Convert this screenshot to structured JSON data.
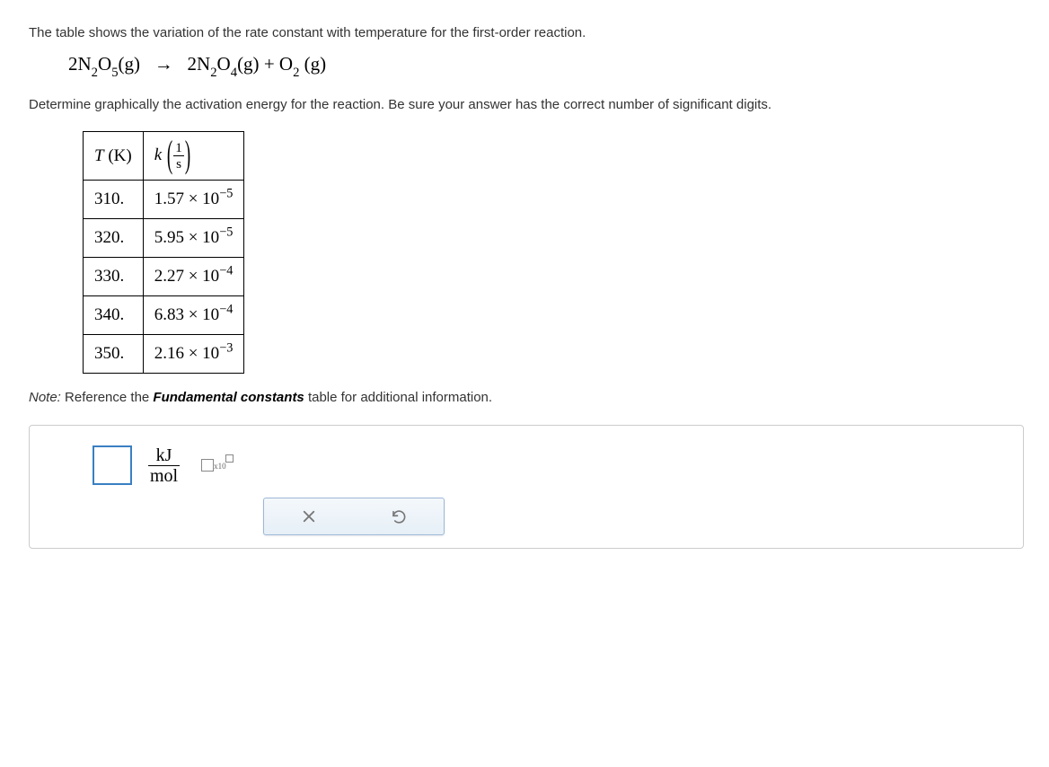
{
  "intro": "The table shows the variation of the rate constant with temperature for the first-order reaction.",
  "equation": {
    "lhs_coef": "2N",
    "lhs_sub1": "2",
    "lhs_mid": "O",
    "lhs_sub2": "5",
    "lhs_phase": "(g)",
    "arrow": "→",
    "rhs_a_coef": "2N",
    "rhs_a_sub1": "2",
    "rhs_a_mid": "O",
    "rhs_a_sub2": "4",
    "rhs_a_phase": "(g)",
    "plus": " + ",
    "rhs_b": "O",
    "rhs_b_sub": "2",
    "rhs_b_phase": "(g)"
  },
  "prompt": "Determine graphically the activation energy for the reaction. Be sure your answer has the correct number of significant digits.",
  "table": {
    "headers": {
      "temp_sym": "T",
      "temp_unit": "(K)",
      "k_sym": "k",
      "frac_num": "1",
      "frac_den": "s"
    },
    "rows": [
      {
        "t": "310.",
        "coef": "1.57",
        "times": " × 10",
        "exp": "−5"
      },
      {
        "t": "320.",
        "coef": "5.95",
        "times": " × 10",
        "exp": "−5"
      },
      {
        "t": "330.",
        "coef": "2.27",
        "times": " × 10",
        "exp": "−4"
      },
      {
        "t": "340.",
        "coef": "6.83",
        "times": " × 10",
        "exp": "−4"
      },
      {
        "t": "350.",
        "coef": "2.16",
        "times": " × 10",
        "exp": "−3"
      }
    ]
  },
  "note": {
    "prefix": "Note:",
    "mid": " Reference the ",
    "ref": "Fundamental constants",
    "suffix": " table for additional information."
  },
  "answer": {
    "unit_num": "kJ",
    "unit_den": "mol",
    "x10": "x10"
  }
}
